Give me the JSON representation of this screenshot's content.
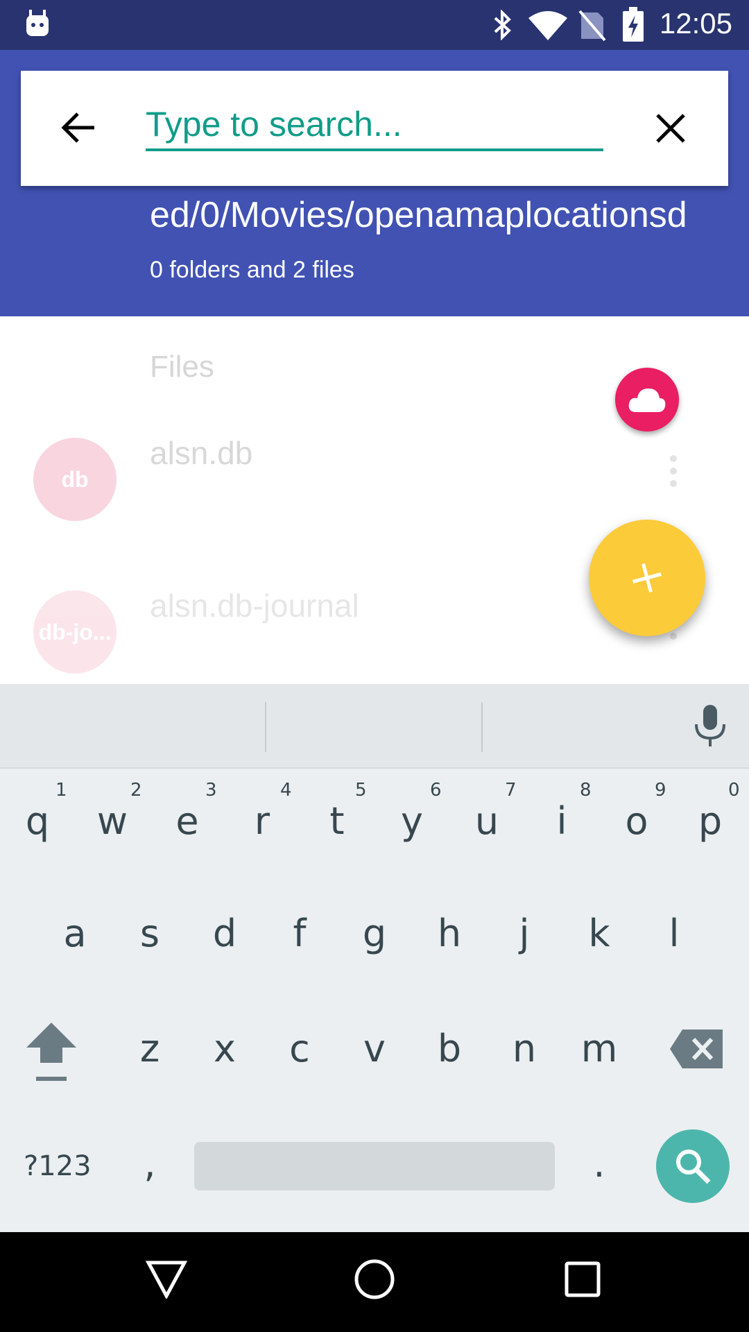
{
  "status_bar": {
    "time": "12:05"
  },
  "search": {
    "placeholder": "Type to search..."
  },
  "location": {
    "path": "ed/0/Movies/openamaplocationsd",
    "summary": "0 folders and 2 files"
  },
  "list": {
    "section_header": "Files",
    "items": [
      {
        "avatar": "db",
        "name": "alsn.db"
      },
      {
        "avatar": "db-jo...",
        "name": "alsn.db-journal"
      }
    ]
  },
  "keyboard": {
    "row1": [
      {
        "key": "q",
        "hint": "1"
      },
      {
        "key": "w",
        "hint": "2"
      },
      {
        "key": "e",
        "hint": "3"
      },
      {
        "key": "r",
        "hint": "4"
      },
      {
        "key": "t",
        "hint": "5"
      },
      {
        "key": "y",
        "hint": "6"
      },
      {
        "key": "u",
        "hint": "7"
      },
      {
        "key": "i",
        "hint": "8"
      },
      {
        "key": "o",
        "hint": "9"
      },
      {
        "key": "p",
        "hint": "0"
      }
    ],
    "row2": [
      "a",
      "s",
      "d",
      "f",
      "g",
      "h",
      "j",
      "k",
      "l"
    ],
    "row3": [
      "z",
      "x",
      "c",
      "v",
      "b",
      "n",
      "m"
    ],
    "symbols_label": "?123",
    "comma": ",",
    "period": "."
  },
  "colors": {
    "appbar": "#4152b3",
    "statusbar": "#283370",
    "accent": "#119c89",
    "fab_cloud": "#e91e63",
    "fab_add": "#fccb3a"
  }
}
